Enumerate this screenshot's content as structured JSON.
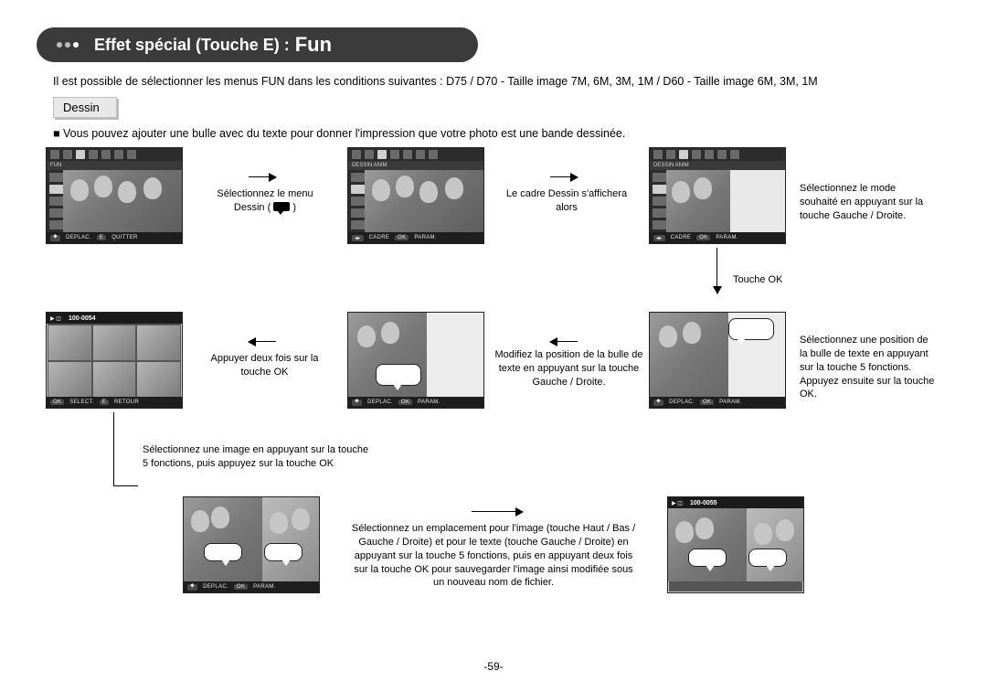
{
  "title": {
    "main": "Effet spécial (Touche E) :",
    "sub": "Fun"
  },
  "intro": "Il est possible de sélectionner les menus FUN dans les conditions suivantes : D75 / D70 - Taille image 7M, 6M, 3M, 1M / D60 - Taille image 6M, 3M, 1M",
  "section_label": "Dessin",
  "bullet": "Vous pouvez ajouter une bulle avec du texte pour donner l'impression que votre photo est une bande dessinée.",
  "captions": {
    "c1a": "Sélectionnez  le menu",
    "c1b": "Dessin (",
    "c1c": ")",
    "c2a": "Le cadre Dessin s'affichera",
    "c2b": "alors",
    "c3a": "Sélectionnez le mode",
    "c3b": "souhaité en appuyant sur la",
    "c3c": "touche Gauche / Droite.",
    "ok": "Touche OK",
    "c4a": "Appuyer deux fois sur la",
    "c4b": "touche OK",
    "c5a": "Modifiez la position de la bulle de",
    "c5b": "texte en appuyant sur la touche",
    "c5c": "Gauche / Droite.",
    "c6a": "Sélectionnez une position de",
    "c6b": "la bulle de texte en appuyant",
    "c6c": "sur la touche 5 fonctions.",
    "c6d": "Appuyez ensuite sur la touche",
    "c6e": "OK.",
    "c7a": "Sélectionnez une image en appuyant sur la touche",
    "c7b": "5 fonctions, puis appuyez sur la touche OK",
    "c8a": "Sélectionnez un emplacement pour l'image (touche Haut / Bas /",
    "c8b": "Gauche / Droite) et pour le texte (touche Gauche / Droite) en",
    "c8c": "appuyant sur la touche 5 fonctions, puis en appuyant deux fois",
    "c8d": "sur la touche OK pour sauvegarder l'image ainsi modifiée sous",
    "c8e": "un nouveau nom de fichier."
  },
  "lcd": {
    "fun": "FUN",
    "dessin_anim": "DESSIN  ANIM",
    "deplac": "DEPLAC.",
    "e": "E",
    "quitter": "QUITTER",
    "cadre": "CADRE",
    "ok": "OK",
    "param": "PARAM.",
    "select": "SELECT.",
    "retour": "RETOUR",
    "file1": "100-0054",
    "file2": "100-0055"
  },
  "pagenum": "-59-"
}
